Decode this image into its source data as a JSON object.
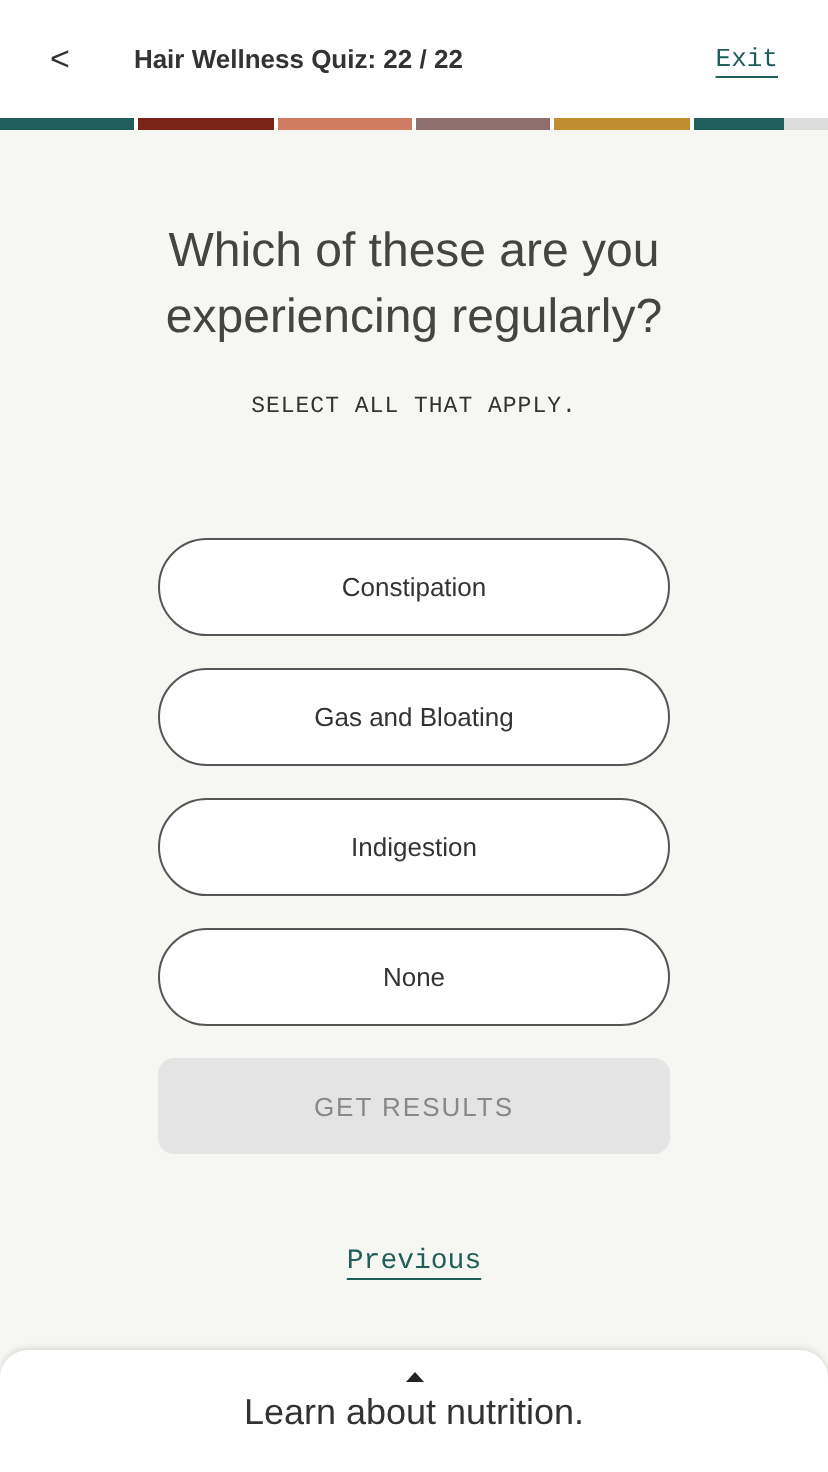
{
  "header": {
    "back": "<",
    "title": "Hair Wellness Quiz: 22 / 22",
    "exit": "Exit"
  },
  "progress": [
    {
      "color": "#1f5e5a",
      "level": 1
    },
    {
      "color": "#7a2418",
      "level": 1
    },
    {
      "color": "#cf7c62",
      "level": 1
    },
    {
      "color": "#8f6e6e",
      "level": 1
    },
    {
      "color": "#c08e2e",
      "level": 1
    },
    {
      "color": "#1f5e5a",
      "level": 0.68
    }
  ],
  "question": "Which of these are you experiencing regularly?",
  "instruction": "SELECT ALL THAT APPLY.",
  "options": [
    {
      "label": "Constipation",
      "selected": false
    },
    {
      "label": "Gas and Bloating",
      "selected": false
    },
    {
      "label": "Indigestion",
      "selected": false
    },
    {
      "label": "None",
      "selected": false
    }
  ],
  "submit": {
    "label": "GET RESULTS",
    "disabled": true
  },
  "previous": "Previous",
  "sheet": {
    "text": "Learn about nutrition."
  }
}
